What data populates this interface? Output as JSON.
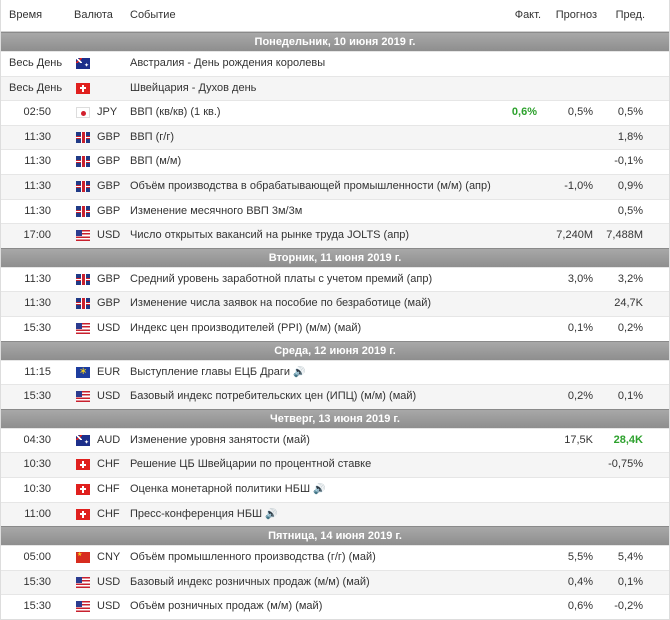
{
  "columns": {
    "time": "Время",
    "currency": "Валюта",
    "event": "Событие",
    "actual": "Факт.",
    "forecast": "Прогноз",
    "previous": "Пред."
  },
  "days": [
    {
      "label": "Понедельник, 10 июня 2019 г.",
      "rows": [
        {
          "time": "Весь День",
          "flag": "au",
          "currency": "",
          "event": "Австралия - День рождения королевы",
          "actual": "",
          "forecast": "",
          "previous": "",
          "speaker": false
        },
        {
          "time": "Весь День",
          "flag": "ch",
          "currency": "",
          "event": "Швейцария - Духов день",
          "actual": "",
          "forecast": "",
          "previous": "",
          "speaker": false
        },
        {
          "time": "02:50",
          "flag": "jp",
          "currency": "JPY",
          "event": "ВВП (кв/кв) (1 кв.)",
          "actual": "0,6%",
          "actual_color": "green",
          "forecast": "0,5%",
          "previous": "0,5%",
          "speaker": false
        },
        {
          "time": "11:30",
          "flag": "gb",
          "currency": "GBP",
          "event": "ВВП (г/г)",
          "actual": "",
          "forecast": "",
          "previous": "1,8%",
          "speaker": false
        },
        {
          "time": "11:30",
          "flag": "gb",
          "currency": "GBP",
          "event": "ВВП (м/м)",
          "actual": "",
          "forecast": "",
          "previous": "-0,1%",
          "speaker": false
        },
        {
          "time": "11:30",
          "flag": "gb",
          "currency": "GBP",
          "event": "Объём производства в обрабатывающей промышленности (м/м) (апр)",
          "actual": "",
          "forecast": "-1,0%",
          "previous": "0,9%",
          "speaker": false
        },
        {
          "time": "11:30",
          "flag": "gb",
          "currency": "GBP",
          "event": "Изменение месячного ВВП 3м/3м",
          "actual": "",
          "forecast": "",
          "previous": "0,5%",
          "speaker": false
        },
        {
          "time": "17:00",
          "flag": "us",
          "currency": "USD",
          "event": "Число открытых вакансий на рынке труда JOLTS (апр)",
          "actual": "",
          "forecast": "7,240M",
          "previous": "7,488M",
          "speaker": false
        }
      ]
    },
    {
      "label": "Вторник, 11 июня 2019 г.",
      "rows": [
        {
          "time": "11:30",
          "flag": "gb",
          "currency": "GBP",
          "event": "Средний уровень заработной платы с учетом премий (апр)",
          "actual": "",
          "forecast": "3,0%",
          "previous": "3,2%",
          "speaker": false
        },
        {
          "time": "11:30",
          "flag": "gb",
          "currency": "GBP",
          "event": "Изменение числа заявок на пособие по безработице (май)",
          "actual": "",
          "forecast": "",
          "previous": "24,7K",
          "speaker": false
        },
        {
          "time": "15:30",
          "flag": "us",
          "currency": "USD",
          "event": "Индекс цен производителей (PPI) (м/м) (май)",
          "actual": "",
          "forecast": "0,1%",
          "previous": "0,2%",
          "speaker": false
        }
      ]
    },
    {
      "label": "Среда, 12 июня 2019 г.",
      "rows": [
        {
          "time": "11:15",
          "flag": "eu",
          "currency": "EUR",
          "event": "Выступление главы ЕЦБ Драги",
          "actual": "",
          "forecast": "",
          "previous": "",
          "speaker": true
        },
        {
          "time": "15:30",
          "flag": "us",
          "currency": "USD",
          "event": "Базовый индекс потребительских цен (ИПЦ) (м/м) (май)",
          "actual": "",
          "forecast": "0,2%",
          "previous": "0,1%",
          "speaker": false
        }
      ]
    },
    {
      "label": "Четверг, 13 июня 2019 г.",
      "rows": [
        {
          "time": "04:30",
          "flag": "au",
          "currency": "AUD",
          "event": "Изменение уровня занятости (май)",
          "actual": "",
          "forecast": "17,5K",
          "previous": "28,4K",
          "previous_color": "green",
          "speaker": false
        },
        {
          "time": "10:30",
          "flag": "ch",
          "currency": "CHF",
          "event": "Решение ЦБ Швейцарии по процентной ставке",
          "actual": "",
          "forecast": "",
          "previous": "-0,75%",
          "speaker": false
        },
        {
          "time": "10:30",
          "flag": "ch",
          "currency": "CHF",
          "event": "Оценка монетарной политики НБШ",
          "actual": "",
          "forecast": "",
          "previous": "",
          "speaker": true
        },
        {
          "time": "11:00",
          "flag": "ch",
          "currency": "CHF",
          "event": "Пресс-конференция НБШ",
          "actual": "",
          "forecast": "",
          "previous": "",
          "speaker": true
        }
      ]
    },
    {
      "label": "Пятница, 14 июня 2019 г.",
      "rows": [
        {
          "time": "05:00",
          "flag": "cn",
          "currency": "CNY",
          "event": "Объём промышленного производства (г/г) (май)",
          "actual": "",
          "forecast": "5,5%",
          "previous": "5,4%",
          "speaker": false
        },
        {
          "time": "15:30",
          "flag": "us",
          "currency": "USD",
          "event": "Базовый индекс розничных продаж (м/м) (май)",
          "actual": "",
          "forecast": "0,4%",
          "previous": "0,1%",
          "speaker": false
        },
        {
          "time": "15:30",
          "flag": "us",
          "currency": "USD",
          "event": "Объём розничных продаж (м/м) (май)",
          "actual": "",
          "forecast": "0,6%",
          "previous": "-0,2%",
          "speaker": false
        }
      ]
    }
  ]
}
